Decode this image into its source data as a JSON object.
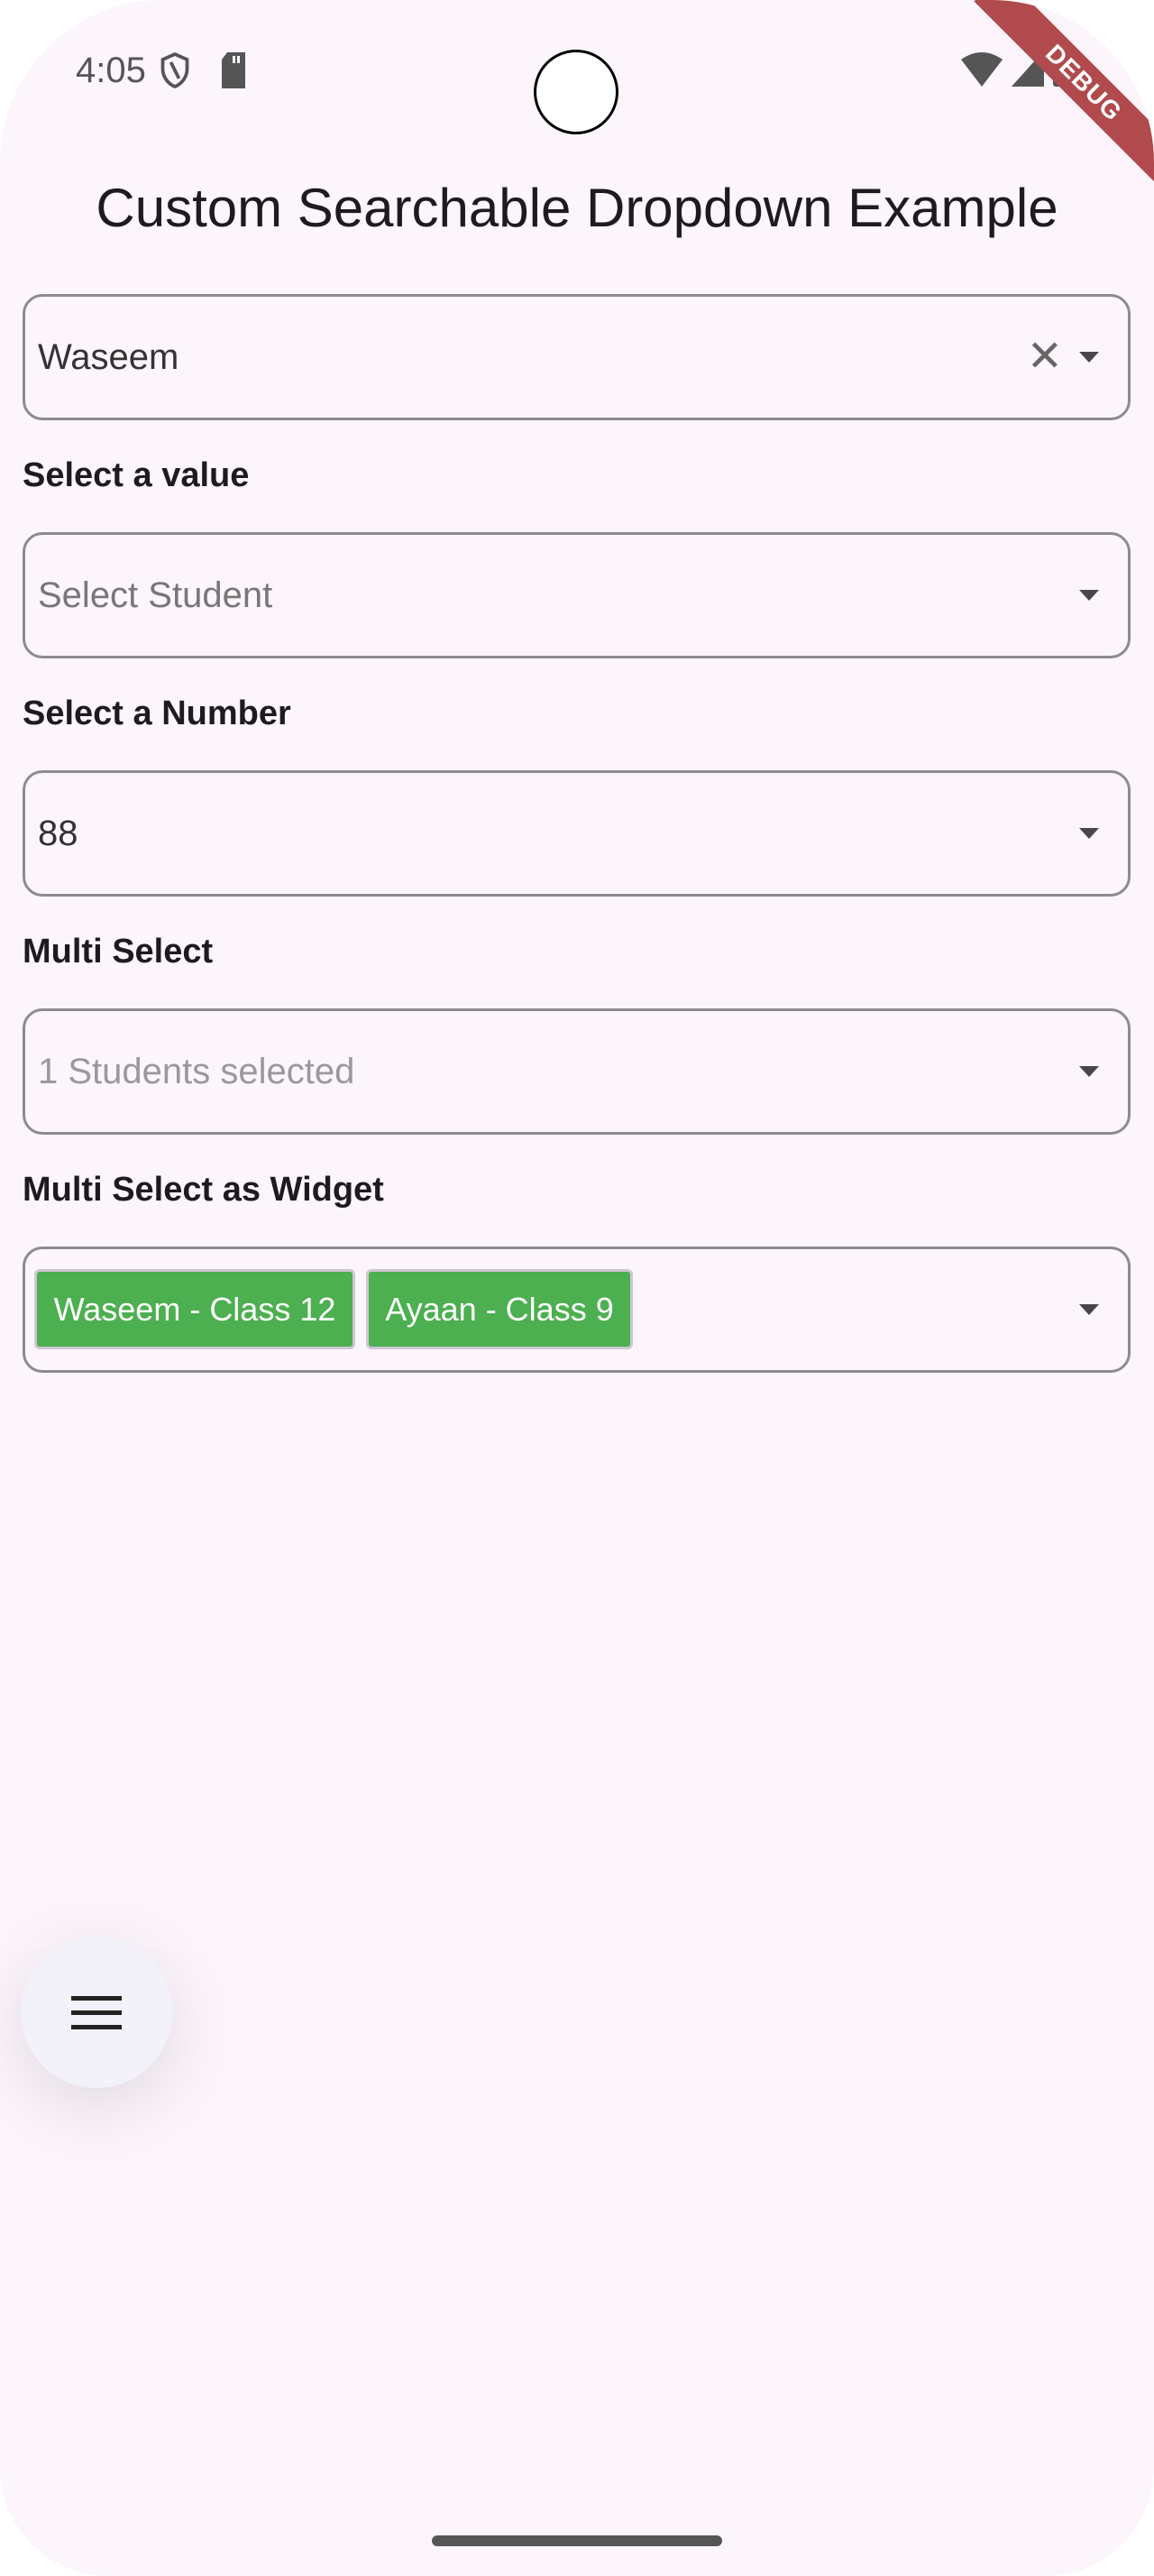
{
  "status_bar": {
    "time": "4:05",
    "debug_banner": "DEBUG"
  },
  "page": {
    "title": "Custom Searchable Dropdown Example"
  },
  "fields": [
    {
      "value": "Waseem",
      "has_clear": true
    },
    {
      "label": "Select a value",
      "placeholder": "Select Student"
    },
    {
      "label": "Select a Number",
      "value": "88"
    },
    {
      "label": "Multi Select",
      "placeholder": "1 Students selected"
    },
    {
      "label": "Multi Select as Widget",
      "chips": [
        "Waseem - Class 12",
        "Ayaan - Class 9"
      ]
    }
  ],
  "colors": {
    "background": "#fcf5fc",
    "chip": "#4caf50",
    "debug": "#b04a4c"
  },
  "icons": {
    "fab": "menu-icon",
    "clear": "close-icon",
    "dropdown": "arrow-drop-down-icon"
  }
}
